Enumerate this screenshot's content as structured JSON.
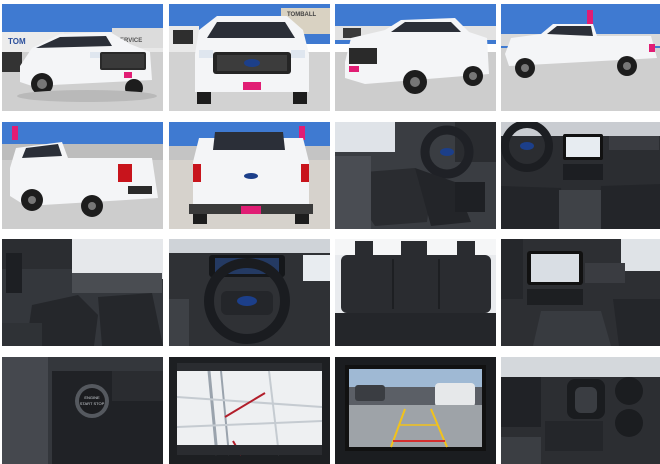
{
  "gallery": {
    "columns": 4,
    "rows": 4,
    "photos": [
      {
        "subject": "front three-quarter view of white pickup truck at dealership"
      },
      {
        "subject": "front view of white pickup truck"
      },
      {
        "subject": "front three-quarter view, passenger side"
      },
      {
        "subject": "side profile, passenger side"
      },
      {
        "subject": "rear three-quarter view, driver side"
      },
      {
        "subject": "rear view with tailgate"
      },
      {
        "subject": "driver seat and steering wheel"
      },
      {
        "subject": "dashboard and infotainment screen"
      },
      {
        "subject": "front seats through open door"
      },
      {
        "subject": "steering wheel and instrument cluster"
      },
      {
        "subject": "rear bench seat"
      },
      {
        "subject": "dashboard from passenger side"
      },
      {
        "subject": "engine start button"
      },
      {
        "subject": "navigation map on touchscreen"
      },
      {
        "subject": "backup camera display"
      },
      {
        "subject": "center console gear shifter"
      }
    ]
  },
  "signage": {
    "dealer_sign": "TOM",
    "service_sign": "SERVICE",
    "dealer_sign_2": "TOMBALL",
    "start_button": "ENGINE START STOP"
  },
  "colors": {
    "truck_white": "#f4f5f7",
    "sky": "#3f7ad1",
    "pavement": "#cfcfcf",
    "interior_dark": "#2b2d31"
  }
}
